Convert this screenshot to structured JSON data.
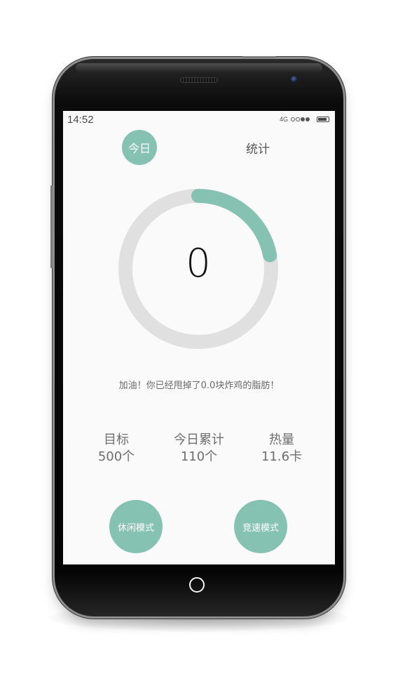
{
  "status_bar": {
    "time": "14:52",
    "network": "4G"
  },
  "tabs": {
    "today_label": "今日",
    "stats_label": "统计"
  },
  "progress": {
    "count": "0",
    "fraction": 0.22
  },
  "message": "加油！你已经甩掉了0.0块炸鸡的脂肪！",
  "stats": [
    {
      "label": "目标",
      "value": "500个"
    },
    {
      "label": "今日累计",
      "value": "110个"
    },
    {
      "label": "热量",
      "value": "11.6卡"
    }
  ],
  "modes": {
    "leisure_label": "休闲模式",
    "race_label": "竞速模式"
  },
  "colors": {
    "accent": "#86c2b1",
    "track": "#e0e0e0",
    "screen_bg": "#fafafa"
  }
}
